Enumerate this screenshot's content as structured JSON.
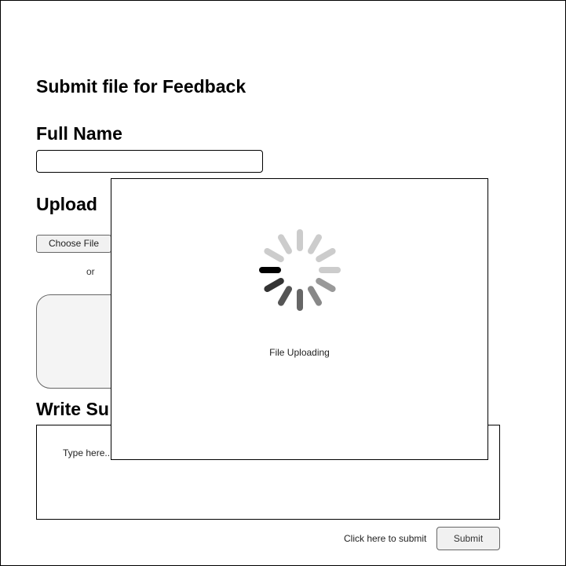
{
  "form": {
    "title": "Submit file for Feedback",
    "full_name_label": "Full Name",
    "full_name_value": "",
    "upload_label": "Upload",
    "choose_file_label": "Choose File",
    "or_text": "or",
    "summary_label": "Write Su",
    "summary_placeholder": "Type here...",
    "submit_hint": "Click here to submit",
    "submit_label": "Submit"
  },
  "modal": {
    "caption": "File Uploading",
    "spinner_icon": "loading-spinner-icon"
  },
  "colors": {
    "dropzone_bg": "#f4f4f4",
    "button_bg": "#f1f1f1",
    "spinner_active": "#000000",
    "spinner_inactive": "#cccccc"
  }
}
